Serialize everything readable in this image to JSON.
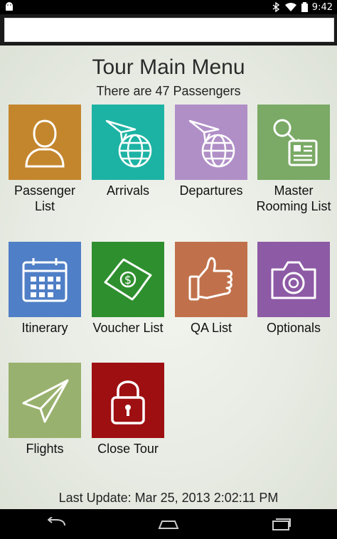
{
  "status_bar": {
    "time": "9:42",
    "icons": [
      "android-icon",
      "bluetooth-icon",
      "wifi-icon",
      "battery-icon"
    ]
  },
  "header": {
    "title": "Tour Main Menu",
    "subtitle": "There are 47 Passengers"
  },
  "tiles": [
    {
      "label_lines": [
        "Passenger",
        "List"
      ],
      "icon": "person-icon",
      "color": "#c4862d"
    },
    {
      "label_lines": [
        "Arrivals"
      ],
      "icon": "plane-globe-icon",
      "color": "#1db3a4"
    },
    {
      "label_lines": [
        "Departures"
      ],
      "icon": "plane-globe-icon",
      "color": "#b08fc7"
    },
    {
      "label_lines": [
        "Master",
        "Rooming List"
      ],
      "icon": "key-document-icon",
      "color": "#7aaa66"
    },
    {
      "label_lines": [
        "Itinerary"
      ],
      "icon": "calendar-icon",
      "color": "#4f7fc6"
    },
    {
      "label_lines": [
        "Voucher List"
      ],
      "icon": "money-icon",
      "color": "#2e8f2e"
    },
    {
      "label_lines": [
        "QA List"
      ],
      "icon": "thumbs-up-icon",
      "color": "#c0714b"
    },
    {
      "label_lines": [
        "Optionals"
      ],
      "icon": "camera-icon",
      "color": "#8d5aa5"
    },
    {
      "label_lines": [
        "Flights"
      ],
      "icon": "paper-plane-icon",
      "color": "#99b16e"
    },
    {
      "label_lines": [
        "Close Tour"
      ],
      "icon": "padlock-icon",
      "color": "#9e0f12"
    }
  ],
  "footer": {
    "last_update": "Last Update: Mar 25, 2013 2:02:11 PM"
  },
  "nav": {
    "buttons": [
      "back-icon",
      "home-icon",
      "recent-apps-icon"
    ]
  }
}
